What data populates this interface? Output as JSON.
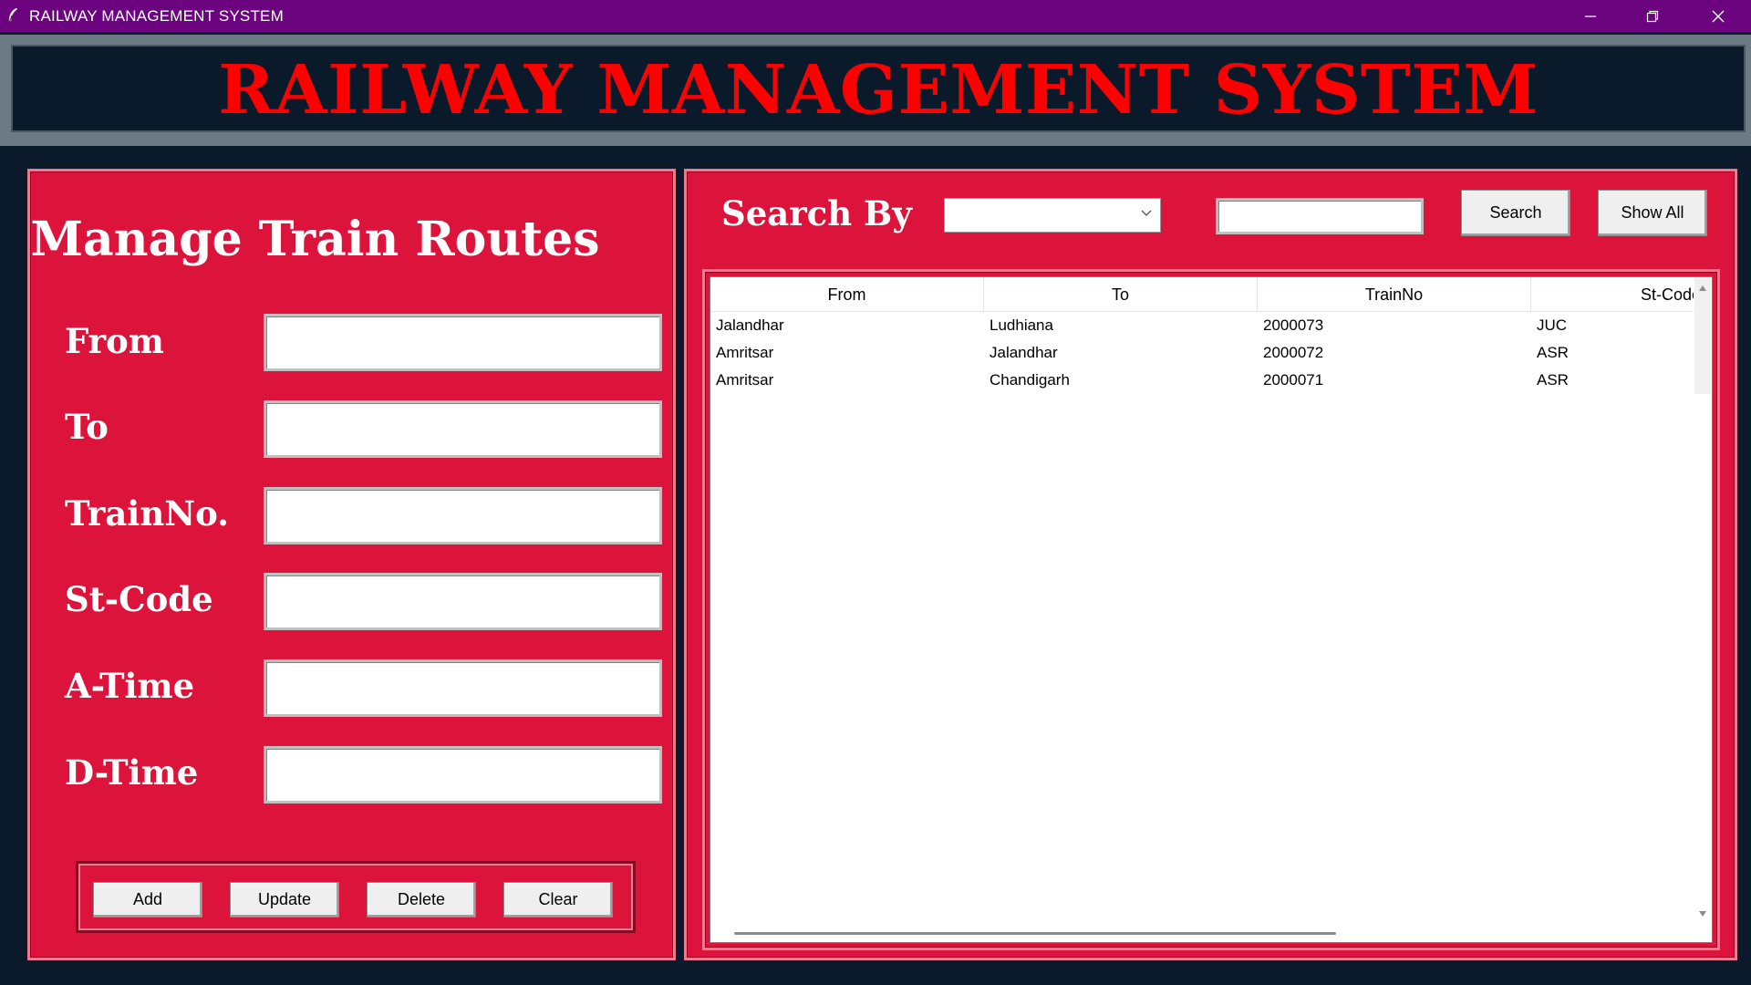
{
  "window": {
    "title": "RAILWAY MANAGEMENT SYSTEM",
    "minimize_icon": "minimize-icon",
    "restore_icon": "restore-icon",
    "close_icon": "close-icon"
  },
  "header": {
    "title": "RAILWAY MANAGEMENT SYSTEM"
  },
  "form": {
    "title": "Manage Train Routes",
    "fields": [
      {
        "label": "From",
        "value": ""
      },
      {
        "label": "To",
        "value": ""
      },
      {
        "label": "TrainNo.",
        "value": ""
      },
      {
        "label": "St-Code",
        "value": ""
      },
      {
        "label": "A-Time",
        "value": ""
      },
      {
        "label": "D-Time",
        "value": ""
      }
    ],
    "buttons": {
      "add": "Add",
      "update": "Update",
      "delete": "Delete",
      "clear": "Clear"
    }
  },
  "search": {
    "label": "Search By",
    "selected": "",
    "query": "",
    "search_button": "Search",
    "show_all_button": "Show All"
  },
  "table": {
    "columns": [
      "From",
      "To",
      "TrainNo",
      "St-Code"
    ],
    "rows": [
      [
        "Jalandhar",
        "Ludhiana",
        "2000073",
        "JUC"
      ],
      [
        "Amritsar",
        "Jalandhar",
        "2000072",
        "ASR"
      ],
      [
        "Amritsar",
        "Chandigarh",
        "2000071",
        "ASR"
      ]
    ]
  },
  "colors": {
    "titlebar": "#6c0480",
    "background": "#0a1a2a",
    "panel": "#dc143c",
    "header_text": "#ff0000"
  }
}
